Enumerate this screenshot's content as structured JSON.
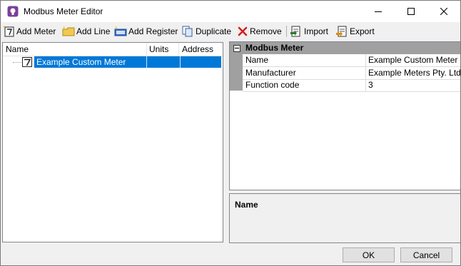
{
  "window": {
    "title": "Modbus Meter Editor"
  },
  "toolbar": {
    "add_meter": "Add Meter",
    "add_line": "Add Line",
    "add_register": "Add Register",
    "duplicate": "Duplicate",
    "remove": "Remove",
    "import": "Import",
    "export": "Export"
  },
  "tree": {
    "columns": [
      "Name",
      "Units",
      "Address"
    ],
    "rows": [
      {
        "name": "Example Custom Meter",
        "units": "",
        "address": ""
      }
    ]
  },
  "properties": {
    "category": "Modbus Meter",
    "rows": [
      {
        "name": "Name",
        "value": "Example Custom Meter"
      },
      {
        "name": "Manufacturer",
        "value": "Example Meters Pty. Ltd."
      },
      {
        "name": "Function code",
        "value": "3"
      }
    ]
  },
  "description": {
    "title": "Name"
  },
  "buttons": {
    "ok": "OK",
    "cancel": "Cancel"
  },
  "colors": {
    "selection": "#0078d7",
    "category_bar": "#a0a0a0",
    "window_bg": "#f0f0f0"
  }
}
